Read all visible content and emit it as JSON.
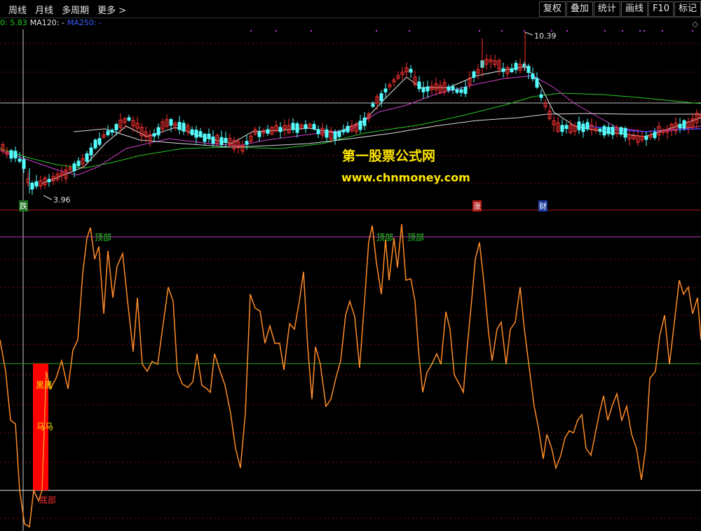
{
  "toolbar": {
    "left_items": [
      "周线",
      "月线",
      "多周期",
      "更多 >"
    ],
    "right_buttons": [
      "复权",
      "叠加",
      "统计",
      "画线",
      "F10",
      "标记"
    ]
  },
  "legend": {
    "ma_a": "0: 5.83",
    "ma120": "MA120: -",
    "ma250": "MA250: -"
  },
  "price_chart": {
    "high_label": "10.39",
    "low_label": "3.96",
    "markers": [
      "跌",
      "涨",
      "财"
    ],
    "colors": {
      "up": "#ff3232",
      "down": "#54ffff",
      "ma_white": "#dcdcdc",
      "ma_magenta": "#d040d0",
      "ma_green": "#28c828",
      "ma_blue": "#3c3cff"
    }
  },
  "watermark": {
    "line1": "第一股票公式网",
    "line2": "www.chnmoney.com"
  },
  "indicator": {
    "labels_top": [
      "顶部",
      "顶部",
      "顶部"
    ],
    "label_black": "黑黑",
    "label_horse": "马马",
    "label_bottom": "底部",
    "colors": {
      "line": "#ff8c28",
      "upper": "#b43cb4",
      "middle": "#28a028",
      "lower": "#e6e6e6",
      "bar": "#ff0000"
    }
  }
}
